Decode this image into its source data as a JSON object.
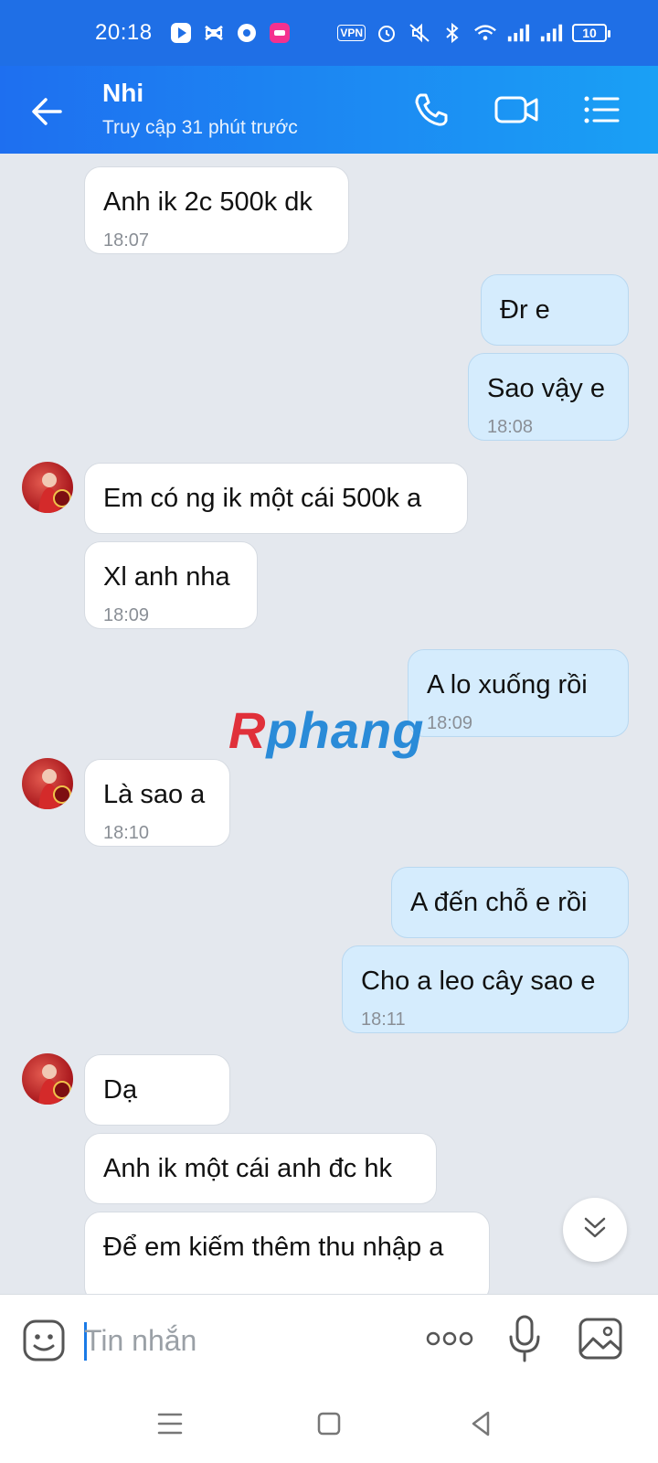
{
  "status_bar": {
    "time": "20:18",
    "battery": "10",
    "vpn": "VPN"
  },
  "header": {
    "name": "Nhi",
    "last_seen": "Truy cập 31 phút trước"
  },
  "messages": [
    {
      "side": "received",
      "text": "Anh ik 2c 500k dk",
      "time": "18:07"
    },
    {
      "side": "sent",
      "text": "Đr e",
      "time": ""
    },
    {
      "side": "sent",
      "text": "Sao vậy e",
      "time": "18:08"
    },
    {
      "side": "received",
      "text": "Em có ng ik một cái 500k a",
      "time": ""
    },
    {
      "side": "received",
      "text": "Xl anh nha",
      "time": "18:09"
    },
    {
      "side": "sent",
      "text": "A lo xuống rồi",
      "time": "18:09"
    },
    {
      "side": "received",
      "text": "Là sao a",
      "time": "18:10"
    },
    {
      "side": "sent",
      "text": "A đến chỗ e rồi",
      "time": ""
    },
    {
      "side": "sent",
      "text": "Cho a leo cây sao e",
      "time": "18:11"
    },
    {
      "side": "received",
      "text": "Dạ",
      "time": ""
    },
    {
      "side": "received",
      "text": "Anh ik một cái anh đc hk",
      "time": ""
    },
    {
      "side": "received",
      "text": "Để em kiếm thêm thu nhập a",
      "time": ""
    }
  ],
  "watermark": {
    "part1": "R",
    "part2": "phang"
  },
  "input": {
    "placeholder": "Tin nhắn",
    "value": ""
  },
  "icons": {
    "back": "back-arrow-icon",
    "call": "phone-icon",
    "video": "video-call-icon",
    "menu": "list-menu-icon",
    "sticker": "sticker-icon",
    "more": "more-dots-icon",
    "mic": "microphone-icon",
    "image": "image-icon"
  },
  "colors": {
    "header": "#1e6ff0",
    "sent_bubble": "#d5ecfd",
    "received_bubble": "#ffffff",
    "chat_bg": "#e4e8ee"
  }
}
